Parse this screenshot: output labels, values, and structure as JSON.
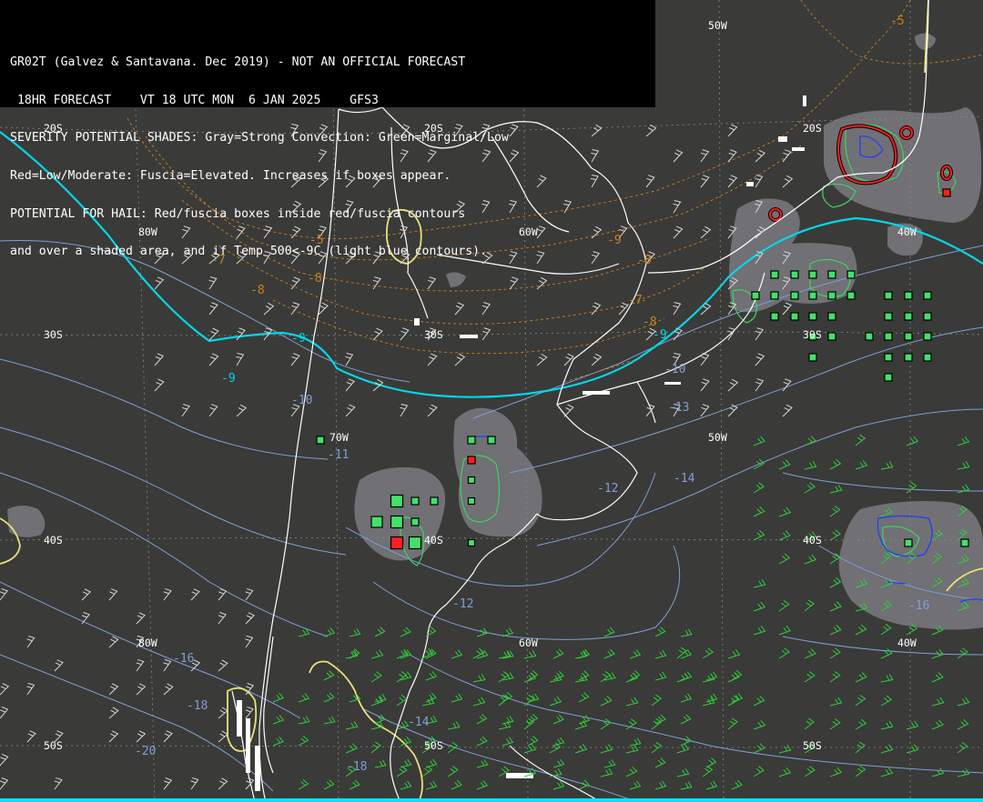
{
  "header": {
    "lines": [
      "GR02T (Galvez & Santavana. Dec 2019) - NOT AN OFFICIAL FORECAST",
      " 18HR FORECAST    VT 18 UTC MON  6 JAN 2025    GFS3",
      "SEVERITY POTENTIAL SHADES: Gray=Strong Convection: Green=Marginal/Low",
      "Red=Low/Moderate: Fuscia=Elevated. Increases if boxes appear.",
      "POTENTIAL FOR HAIL: Red/fuscia boxes inside red/fuscia contours",
      "and over a shaded area, and if Temp 500<-9C (light blue contours)."
    ]
  },
  "grid_labels": {
    "lat": [
      {
        "text": "20S"
      },
      {
        "text": "20S"
      },
      {
        "text": "20S"
      },
      {
        "text": "30S"
      },
      {
        "text": "30S"
      },
      {
        "text": "30S"
      },
      {
        "text": "40S"
      },
      {
        "text": "40S"
      },
      {
        "text": "40S"
      },
      {
        "text": "50S"
      },
      {
        "text": "50S"
      },
      {
        "text": "50S"
      }
    ],
    "lon": [
      {
        "text": "80W"
      },
      {
        "text": "60W"
      },
      {
        "text": "50W"
      },
      {
        "text": "40W"
      },
      {
        "text": "70W"
      },
      {
        "text": "50W"
      },
      {
        "text": "80W"
      },
      {
        "text": "60W"
      },
      {
        "text": "40W"
      }
    ]
  },
  "temp_labels": {
    "cyan": [
      "-9",
      "-9",
      "-9"
    ],
    "blue": [
      "-10",
      "-11",
      "-12",
      "-12",
      "-13",
      "-14",
      "-16",
      "-16",
      "-18",
      "-18",
      "-20",
      "-14",
      "-10"
    ],
    "orange": [
      "-5",
      "-5",
      "-7",
      "-8",
      "-8",
      "-9",
      "-8",
      "-7",
      "-8"
    ]
  },
  "colors": {
    "background": "#3a3a38",
    "coast": "#ffffff",
    "cyan_contour": "#00d8e8",
    "blue_contour": "#7f9fd8",
    "orange_contour": "#c9801c",
    "yellow_contour": "#eae07a",
    "gray_shade": "#7a7a80",
    "green_box": "#44e06a",
    "red_box": "#ff2020",
    "barb_white": "#d8d8d8",
    "barb_green": "#2fcf3a"
  },
  "legend": {
    "shade_gray": "Strong Convection",
    "box_green": "Marginal/Low",
    "box_red": "Low/Moderate"
  }
}
